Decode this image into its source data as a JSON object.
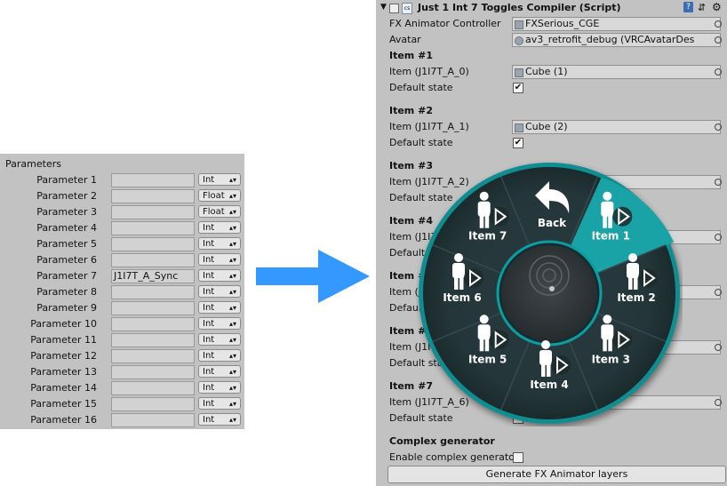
{
  "parameters": {
    "header": "Parameters",
    "rows": [
      {
        "label": "Parameter 1",
        "value": "",
        "type": "Int"
      },
      {
        "label": "Parameter 2",
        "value": "",
        "type": "Float"
      },
      {
        "label": "Parameter 3",
        "value": "",
        "type": "Float"
      },
      {
        "label": "Parameter 4",
        "value": "",
        "type": "Int"
      },
      {
        "label": "Parameter 5",
        "value": "",
        "type": "Int"
      },
      {
        "label": "Parameter 6",
        "value": "",
        "type": "Int"
      },
      {
        "label": "Parameter 7",
        "value": "J1I7T_A_Sync",
        "type": "Int"
      },
      {
        "label": "Parameter 8",
        "value": "",
        "type": "Int"
      },
      {
        "label": "Parameter 9",
        "value": "",
        "type": "Int"
      },
      {
        "label": "Parameter 10",
        "value": "",
        "type": "Int"
      },
      {
        "label": "Parameter 11",
        "value": "",
        "type": "Int"
      },
      {
        "label": "Parameter 12",
        "value": "",
        "type": "Int"
      },
      {
        "label": "Parameter 13",
        "value": "",
        "type": "Int"
      },
      {
        "label": "Parameter 14",
        "value": "",
        "type": "Int"
      },
      {
        "label": "Parameter 15",
        "value": "",
        "type": "Int"
      },
      {
        "label": "Parameter 16",
        "value": "",
        "type": "Int"
      }
    ]
  },
  "inspector": {
    "title": "Just 1 Int 7 Toggles Compiler (Script)",
    "fx_label": "FX Animator Controller",
    "fx_value": "FXSerious_CGE",
    "avatar_label": "Avatar",
    "avatar_value": "av3_retrofit_debug (VRCAvatarDes",
    "items": [
      {
        "title": "Item #1",
        "label": "Item (J1I7T_A_0)",
        "value": "Cube (1)",
        "default_label": "Default state",
        "checked": "✔"
      },
      {
        "title": "Item #2",
        "label": "Item (J1I7T_A_1)",
        "value": "Cube (2)",
        "default_label": "Default state",
        "checked": "✔"
      },
      {
        "title": "Item #3",
        "label": "Item (J1I7T_A_2)",
        "value": "",
        "default_label": "Default state",
        "checked": ""
      },
      {
        "title": "Item #4",
        "label": "Item (J1I7T_A_3)",
        "value": "",
        "default_label": "Default state",
        "checked": ""
      },
      {
        "title": "Item #5",
        "label": "Item (J1I7T_A_4)",
        "value": "",
        "default_label": "Default state",
        "checked": ""
      },
      {
        "title": "Item #6",
        "label": "Item (J1I7T_A_5)",
        "value": "",
        "default_label": "Default state",
        "checked": ""
      },
      {
        "title": "Item #7",
        "label": "Item (J1I7T_A_6)",
        "value": "",
        "default_label": "Default state",
        "checked": ""
      }
    ],
    "complex_title": "Complex generator",
    "complex_label": "Enable complex generator",
    "button_label": "Generate FX Animator layers"
  },
  "radial_menu": {
    "back_label": "Back",
    "items": [
      "Item 1",
      "Item 2",
      "Item 3",
      "Item 4",
      "Item 5",
      "Item 6",
      "Item 7"
    ],
    "accent_color": "#1aa3a6"
  }
}
